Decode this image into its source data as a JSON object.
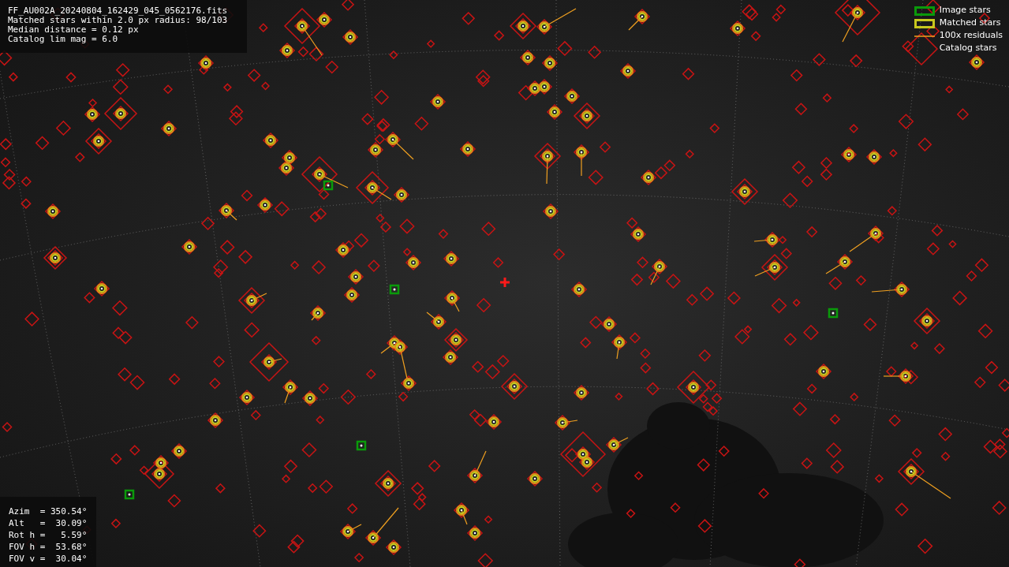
{
  "info_box": {
    "lines": [
      "FF_AU002A_20240804_162429_045_0562176.fits",
      "Matched stars within 2.0 px radius: 98/103",
      "Median distance = 0.12 px",
      "Catalog lim mag = 6.0"
    ]
  },
  "legend": {
    "items": [
      {
        "kind": "image",
        "label": "Image stars"
      },
      {
        "kind": "matched",
        "label": "Matched stars"
      },
      {
        "kind": "residual",
        "label": "100x residuals"
      },
      {
        "kind": "catalog",
        "label": "Catalog stars"
      }
    ]
  },
  "pointing_box": {
    "lines": [
      "Azim  = 350.54°",
      "Alt   =  30.09°",
      "Rot h =   5.59°",
      "FOV h =  53.68°",
      "FOV v =  30.04°"
    ]
  }
}
